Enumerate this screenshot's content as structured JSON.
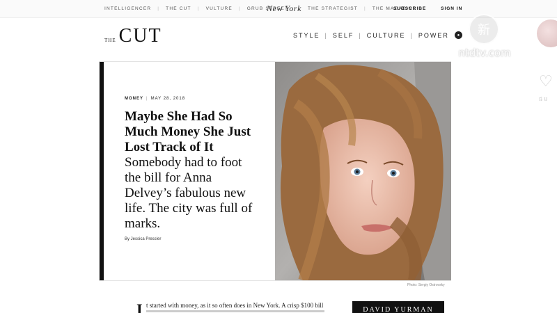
{
  "topbar": {
    "links": [
      "INTELLIGENCER",
      "THE CUT",
      "VULTURE",
      "GRUB STREET"
    ],
    "logo": "New York",
    "links_right": [
      "THE STRATEGIST",
      "THE MAGAZINE"
    ],
    "subscribe": "SUBSCRIBE",
    "sign_in": "SIGN IN"
  },
  "brand": {
    "the": "THE",
    "name": "CUT"
  },
  "nav": {
    "items": [
      "STYLE",
      "SELF",
      "CULTURE",
      "POWER"
    ]
  },
  "watermark": {
    "glyph": "新",
    "domain": "ntdtv.com"
  },
  "article": {
    "section": "MONEY",
    "date": "MAY 28, 2018",
    "headline": "Maybe She Had So Much Money She Just Lost Track of It",
    "dek": "Somebody had to foot the bill for Anna Delvey’s fabulous new life. The city was full of marks.",
    "byline": "By Jessica Pressler",
    "photo_credit": "Photo: Sergiy Ostrovsky",
    "dropcap": "I",
    "body_first_line": "t started with money, as it so often does in New York. A crisp $100 bill"
  },
  "ad": {
    "label": "DAVID YURMAN"
  },
  "sidebar": {
    "text": "ផ ម"
  },
  "colors": {
    "text": "#111111",
    "accent_bar": "#111111",
    "topbar_bg": "#fafafa"
  }
}
